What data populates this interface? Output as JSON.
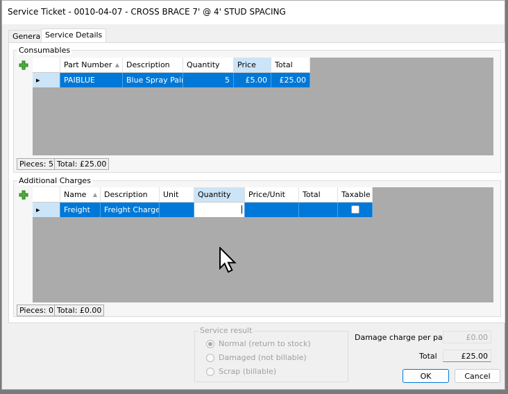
{
  "window": {
    "title": "Service Ticket - 0010-04-07 - CROSS BRACE 7' @ 4' STUD SPACING"
  },
  "tabs": [
    {
      "label": "General",
      "active": false
    },
    {
      "label": "Service Details",
      "active": true
    }
  ],
  "consumables": {
    "label": "Consumables",
    "columns": [
      "Part Number",
      "Description",
      "Quantity",
      "Price",
      "Total"
    ],
    "rows": [
      [
        "PAIBLUE",
        "Blue Spray Paint",
        "5",
        "£5.00",
        "£25.00"
      ]
    ],
    "pieces": "Pieces: 5",
    "total": "Total: £25.00"
  },
  "additional": {
    "label": "Additional Charges",
    "columns": [
      "Name",
      "Description",
      "Unit",
      "Quantity",
      "Price/Unit",
      "Total",
      "Taxable"
    ],
    "rows": [
      [
        "Freight",
        "Freight Charge",
        "",
        "",
        "",
        "",
        ""
      ]
    ],
    "taxable_checked": false,
    "pieces": "Pieces: 0",
    "total": "Total: £0.00"
  },
  "service_result": {
    "label": "Service result",
    "options": [
      "Normal (return to stock)",
      "Damaged (not billable)",
      "Scrap (billable)"
    ],
    "selected": 0
  },
  "summary": {
    "damage_label": "Damage charge per part",
    "damage_value": "£0.00",
    "total_label": "Total",
    "total_value": "£25.00"
  },
  "buttons": {
    "ok": "OK",
    "cancel": "Cancel"
  },
  "colors": {
    "selection": "#0078d7",
    "header_selected": "#cce4f7",
    "grid_bg": "#ababab"
  }
}
